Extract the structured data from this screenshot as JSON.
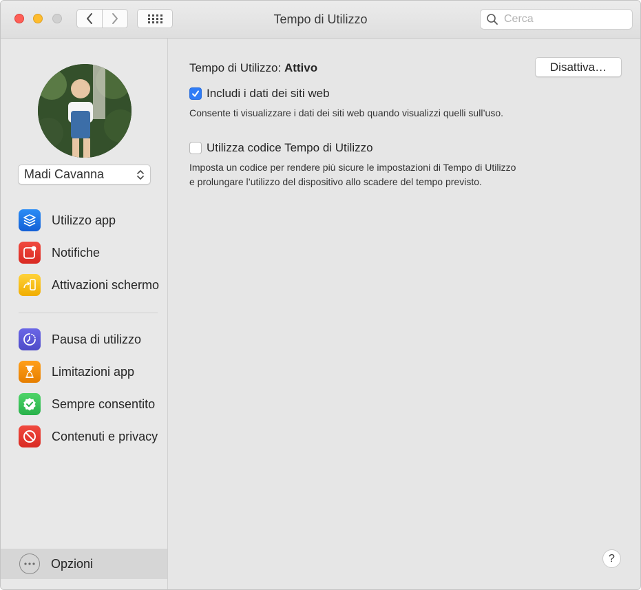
{
  "window": {
    "title": "Tempo di Utilizzo"
  },
  "search": {
    "placeholder": "Cerca"
  },
  "sidebar": {
    "user": "Madi Cavanna",
    "group1": [
      {
        "label": "Utilizzo app",
        "icon": "app-usage-icon",
        "color": "#1a73e8"
      },
      {
        "label": "Notifiche",
        "icon": "notifications-icon",
        "color": "#e5362f"
      },
      {
        "label": "Attivazioni schermo",
        "icon": "pickups-icon",
        "color": "#f5b800"
      }
    ],
    "group2": [
      {
        "label": "Pausa di utilizzo",
        "icon": "downtime-icon",
        "color": "#5856d6"
      },
      {
        "label": "Limitazioni app",
        "icon": "app-limits-icon",
        "color": "#f08a00"
      },
      {
        "label": "Sempre consentito",
        "icon": "always-allowed-icon",
        "color": "#34c759"
      },
      {
        "label": "Contenuti e privacy",
        "icon": "content-privacy-icon",
        "color": "#e5362f"
      }
    ],
    "options": "Opzioni"
  },
  "main": {
    "status_prefix": "Tempo di Utilizzo:",
    "status_value": "Attivo",
    "disable_button": "Disattiva…",
    "include_websites": {
      "label": "Includi i dati dei siti web",
      "checked": true,
      "description": "Consente ti visualizzare i dati dei siti web quando visualizzi quelli sull’uso."
    },
    "use_passcode": {
      "label": "Utilizza codice Tempo di Utilizzo",
      "checked": false,
      "description_line1": "Imposta un codice per rendere più sicure le impostazioni di Tempo di Utilizzo",
      "description_line2": "e prolungare l’utilizzo del dispositivo allo scadere del tempo previsto."
    },
    "help": "?"
  },
  "colors": {
    "accent": "#2f7cf6",
    "sidebar_bg": "#e8e8e8",
    "content_bg": "#e6e6e6"
  }
}
